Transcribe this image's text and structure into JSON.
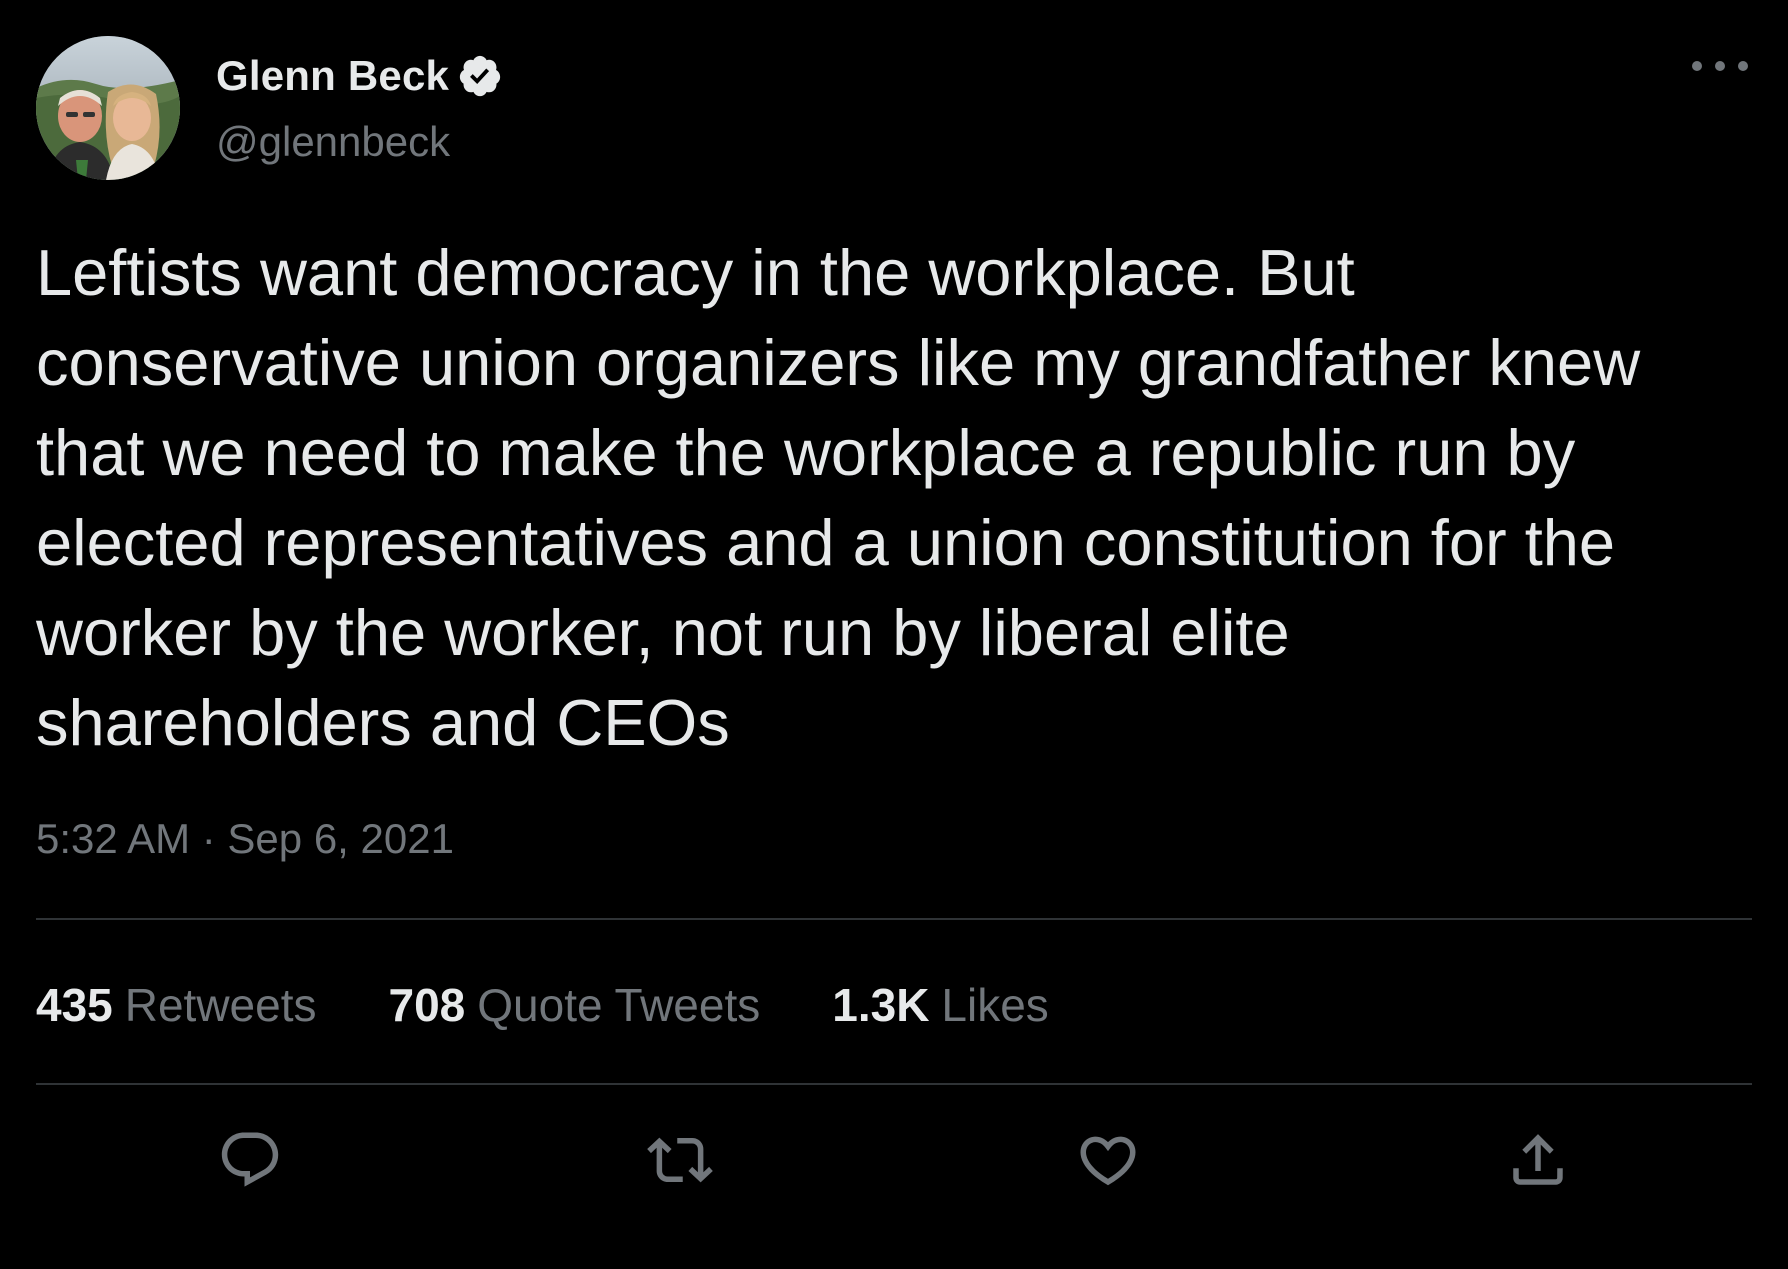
{
  "author": {
    "name": "Glenn Beck",
    "handle": "@glennbeck",
    "verified": true,
    "avatar_icon": "profile-photo"
  },
  "tweet": {
    "text": "Leftists want democracy in the workplace. But\nconservative union organizers like my grandfather knew\nthat we need to make the workplace a republic run by\nelected representatives and a union constitution for the\nworker by the worker, not run by liberal elite\nshareholders and CEOs",
    "timestamp": "5:32 AM · Sep 6, 2021"
  },
  "stats": {
    "retweets": {
      "count": "435",
      "label": "Retweets"
    },
    "quote_tweets": {
      "count": "708",
      "label": "Quote Tweets"
    },
    "likes": {
      "count": "1.3K",
      "label": "Likes"
    }
  },
  "actions": {
    "icons": [
      "reply-icon",
      "retweet-icon",
      "like-icon",
      "share-icon"
    ]
  },
  "colors": {
    "background": "#000000",
    "primary_text": "#e7e9ea",
    "secondary_text": "#71767b",
    "divider": "#2f3336"
  }
}
